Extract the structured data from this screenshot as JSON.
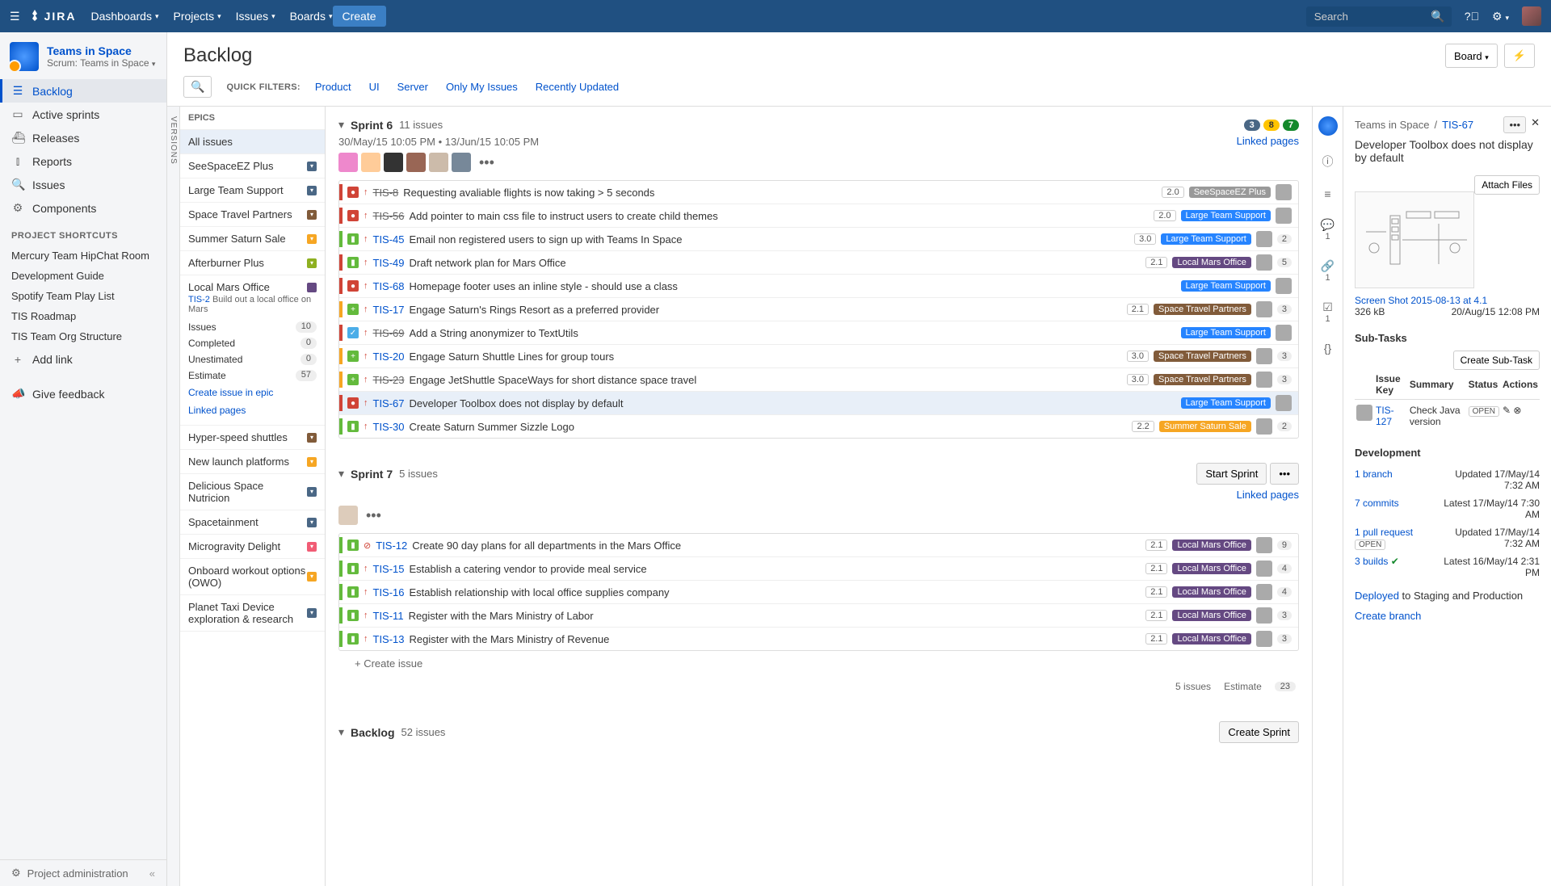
{
  "topnav": {
    "logo": "JIRA",
    "menu": [
      "Dashboards",
      "Projects",
      "Issues",
      "Boards"
    ],
    "create": "Create",
    "search_placeholder": "Search"
  },
  "project": {
    "name": "Teams in Space",
    "subtitle": "Scrum: Teams in Space"
  },
  "sidebar": {
    "items": [
      {
        "icon": "☰",
        "label": "Backlog",
        "active": true
      },
      {
        "icon": "▭",
        "label": "Active sprints"
      },
      {
        "icon": "⛴",
        "label": "Releases"
      },
      {
        "icon": "⫾",
        "label": "Reports"
      },
      {
        "icon": "🔍",
        "label": "Issues"
      },
      {
        "icon": "⚙",
        "label": "Components"
      }
    ],
    "shortcuts_hdr": "PROJECT SHORTCUTS",
    "shortcuts": [
      "Mercury Team HipChat Room",
      "Development Guide",
      "Spotify Team Play List",
      "TIS Roadmap",
      "TIS Team Org Structure"
    ],
    "add_link": "Add link",
    "feedback": "Give feedback",
    "admin": "Project administration"
  },
  "page": {
    "title": "Backlog",
    "board_btn": "Board",
    "filters_label": "QUICK FILTERS:",
    "filters": [
      "Product",
      "UI",
      "Server",
      "Only My Issues",
      "Recently Updated"
    ]
  },
  "versions_tab": "VERSIONS",
  "epics": {
    "hdr": "EPICS",
    "all": "All issues",
    "list": [
      {
        "name": "SeeSpaceEZ Plus",
        "color": "#4a6785"
      },
      {
        "name": "Large Team Support",
        "color": "#4a6785"
      },
      {
        "name": "Space Travel Partners",
        "color": "#815b3a"
      },
      {
        "name": "Summer Saturn Sale",
        "color": "#f6a623"
      },
      {
        "name": "Afterburner Plus",
        "color": "#8eb021"
      }
    ],
    "expanded": {
      "name": "Local Mars Office",
      "color": "#654982",
      "key": "TIS-2",
      "sub": "Build out a local office on Mars",
      "stats": [
        {
          "label": "Issues",
          "val": "10"
        },
        {
          "label": "Completed",
          "val": "0"
        },
        {
          "label": "Unestimated",
          "val": "0"
        },
        {
          "label": "Estimate",
          "val": "57"
        }
      ],
      "links": [
        "Create issue in epic",
        "Linked pages"
      ]
    },
    "rest": [
      {
        "name": "Hyper-speed shuttles",
        "color": "#815b3a"
      },
      {
        "name": "New launch platforms",
        "color": "#f6a623"
      },
      {
        "name": "Delicious Space Nutricion",
        "color": "#4a6785"
      },
      {
        "name": "Spacetainment",
        "color": "#4a6785"
      },
      {
        "name": "Microgravity Delight",
        "color": "#f15c75"
      },
      {
        "name": "Onboard workout options (OWO)",
        "color": "#f6a623"
      },
      {
        "name": "Planet Taxi Device exploration & research",
        "color": "#4a6785"
      }
    ]
  },
  "sprint6": {
    "name": "Sprint 6",
    "count": "11 issues",
    "date1": "30/May/15 10:05 PM",
    "date2": "13/Jun/15 10:05 PM",
    "linked": "Linked pages",
    "badges": {
      "grey": "3",
      "yellow": "8",
      "green": "7"
    },
    "issues": [
      {
        "bar": "#d04437",
        "type": "bug",
        "key": "TIS-8",
        "done": true,
        "sum": "Requesting avaliable flights is now taking > 5 seconds",
        "ver": "2.0",
        "epic": "SeeSpaceEZ Plus",
        "ec": "#999"
      },
      {
        "bar": "#d04437",
        "type": "bug",
        "key": "TIS-56",
        "done": true,
        "sum": "Add pointer to main css file to instruct users to create child themes",
        "ver": "2.0",
        "epic": "Large Team Support",
        "ec": "#2684ff"
      },
      {
        "bar": "#63ba3c",
        "type": "story",
        "key": "TIS-45",
        "sum": "Email non registered users to sign up with Teams In Space",
        "ver": "3.0",
        "epic": "Large Team Support",
        "ec": "#2684ff",
        "cnt": "2"
      },
      {
        "bar": "#d04437",
        "type": "story",
        "key": "TIS-49",
        "sum": "Draft network plan for Mars Office",
        "ver": "2.1",
        "epic": "Local Mars Office",
        "ec": "#654982",
        "cnt": "5"
      },
      {
        "bar": "#d04437",
        "type": "bug",
        "key": "TIS-68",
        "sum": "Homepage footer uses an inline style - should use a class",
        "epic": "Large Team Support",
        "ec": "#2684ff"
      },
      {
        "bar": "#f6a623",
        "type": "story+",
        "key": "TIS-17",
        "sum": "Engage Saturn's Rings Resort as a preferred provider",
        "ver": "2.1",
        "epic": "Space Travel Partners",
        "ec": "#815b3a",
        "cnt": "3"
      },
      {
        "bar": "#d04437",
        "type": "task",
        "key": "TIS-69",
        "done": true,
        "sum": "Add a String anonymizer to TextUtils",
        "epic": "Large Team Support",
        "ec": "#2684ff"
      },
      {
        "bar": "#f6a623",
        "type": "story+",
        "key": "TIS-20",
        "sum": "Engage Saturn Shuttle Lines for group tours",
        "ver": "3.0",
        "epic": "Space Travel Partners",
        "ec": "#815b3a",
        "cnt": "3"
      },
      {
        "bar": "#f6a623",
        "type": "story+",
        "key": "TIS-23",
        "done": true,
        "sum": "Engage JetShuttle SpaceWays for short distance space travel",
        "ver": "3.0",
        "epic": "Space Travel Partners",
        "ec": "#815b3a",
        "cnt": "3"
      },
      {
        "bar": "#d04437",
        "type": "bug",
        "key": "TIS-67",
        "sum": "Developer Toolbox does not display by default",
        "epic": "Large Team Support",
        "ec": "#2684ff",
        "selected": true
      },
      {
        "bar": "#63ba3c",
        "type": "story",
        "key": "TIS-30",
        "sum": "Create Saturn Summer Sizzle Logo",
        "ver": "2.2",
        "epic": "Summer Saturn Sale",
        "ec": "#f6a623",
        "cnt": "2"
      }
    ]
  },
  "sprint7": {
    "name": "Sprint 7",
    "count": "5 issues",
    "start_btn": "Start Sprint",
    "linked": "Linked pages",
    "issues": [
      {
        "bar": "#63ba3c",
        "type": "story",
        "pri": "block",
        "key": "TIS-12",
        "sum": "Create 90 day plans for all departments in the Mars Office",
        "ver": "2.1",
        "epic": "Local Mars Office",
        "ec": "#654982",
        "cnt": "9"
      },
      {
        "bar": "#63ba3c",
        "type": "story",
        "key": "TIS-15",
        "sum": "Establish a catering vendor to provide meal service",
        "ver": "2.1",
        "epic": "Local Mars Office",
        "ec": "#654982",
        "cnt": "4"
      },
      {
        "bar": "#63ba3c",
        "type": "story",
        "key": "TIS-16",
        "sum": "Establish relationship with local office supplies company",
        "ver": "2.1",
        "epic": "Local Mars Office",
        "ec": "#654982",
        "cnt": "4"
      },
      {
        "bar": "#63ba3c",
        "type": "story",
        "key": "TIS-11",
        "sum": "Register with the Mars Ministry of Labor",
        "ver": "2.1",
        "epic": "Local Mars Office",
        "ec": "#654982",
        "cnt": "3"
      },
      {
        "bar": "#63ba3c",
        "type": "story",
        "key": "TIS-13",
        "sum": "Register with the Mars Ministry of Revenue",
        "ver": "2.1",
        "epic": "Local Mars Office",
        "ec": "#654982",
        "cnt": "3"
      }
    ],
    "create": "Create issue",
    "footer_issues": "5 issues",
    "footer_est": "Estimate",
    "footer_val": "23"
  },
  "backlog_section": {
    "name": "Backlog",
    "count": "52 issues",
    "create_btn": "Create Sprint"
  },
  "detail": {
    "project": "Teams in Space",
    "key": "TIS-67",
    "title": "Developer Toolbox does not display by default",
    "attach_btn": "Attach Files",
    "attach_name": "Screen Shot 2015-08-13 at 4.1",
    "attach_size": "326 kB",
    "attach_date": "20/Aug/15 12:08 PM",
    "subtasks_hdr": "Sub-Tasks",
    "create_sub": "Create Sub-Task",
    "sub_cols": [
      "Issue Key",
      "Summary",
      "Status",
      "Actions"
    ],
    "sub_key": "TIS-127",
    "sub_sum": "Check Java version",
    "sub_status": "OPEN",
    "dev_hdr": "Development",
    "dev": [
      {
        "link": "1 branch",
        "txt": "Updated 17/May/14 7:32 AM"
      },
      {
        "link": "7 commits",
        "txt": "Latest 17/May/14 7:30 AM"
      },
      {
        "link": "1 pull request",
        "badge": "OPEN",
        "txt": "Updated 17/May/14 7:32 AM"
      },
      {
        "link": "3 builds",
        "check": true,
        "txt": "Latest 16/May/14 2:31 PM"
      }
    ],
    "deployed_link": "Deployed",
    "deployed_txt": " to Staging and Production",
    "create_branch": "Create branch"
  }
}
